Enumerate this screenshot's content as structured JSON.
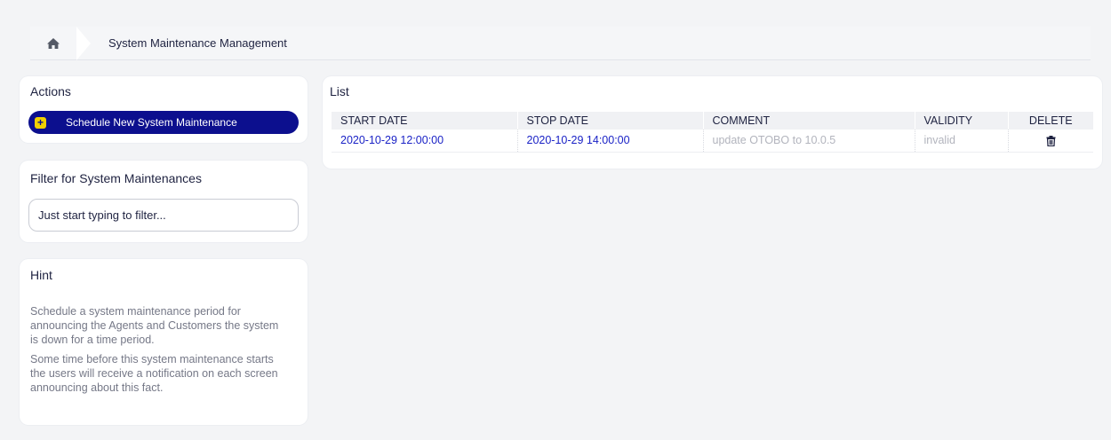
{
  "breadcrumb": {
    "home_icon": "home-icon",
    "current": "System Maintenance Management"
  },
  "actions": {
    "title": "Actions",
    "schedule_button": "Schedule New System Maintenance",
    "schedule_icon": "plus-square-icon"
  },
  "filter": {
    "title": "Filter for System Maintenances",
    "placeholder": "Just start typing to filter..."
  },
  "hint": {
    "title": "Hint",
    "paragraphs": [
      "Schedule a system maintenance period for announcing the Agents and Customers the system is down for a time period.",
      "Some time before this system maintenance starts the users will receive a notification on each screen announcing about this fact."
    ]
  },
  "list": {
    "title": "List",
    "columns": [
      "START DATE",
      "STOP DATE",
      "COMMENT",
      "VALIDITY",
      "DELETE"
    ],
    "rows": [
      {
        "start_date": "2020-10-29 12:00:00",
        "stop_date": "2020-10-29 14:00:00",
        "comment": "update OTOBO to 10.0.5",
        "validity": "invalid",
        "delete_icon": "trash-icon"
      }
    ]
  },
  "colors": {
    "primary": "#0c0f8e",
    "accent": "#f0d000",
    "link": "#1a22c6",
    "background": "#f3f4f6"
  }
}
